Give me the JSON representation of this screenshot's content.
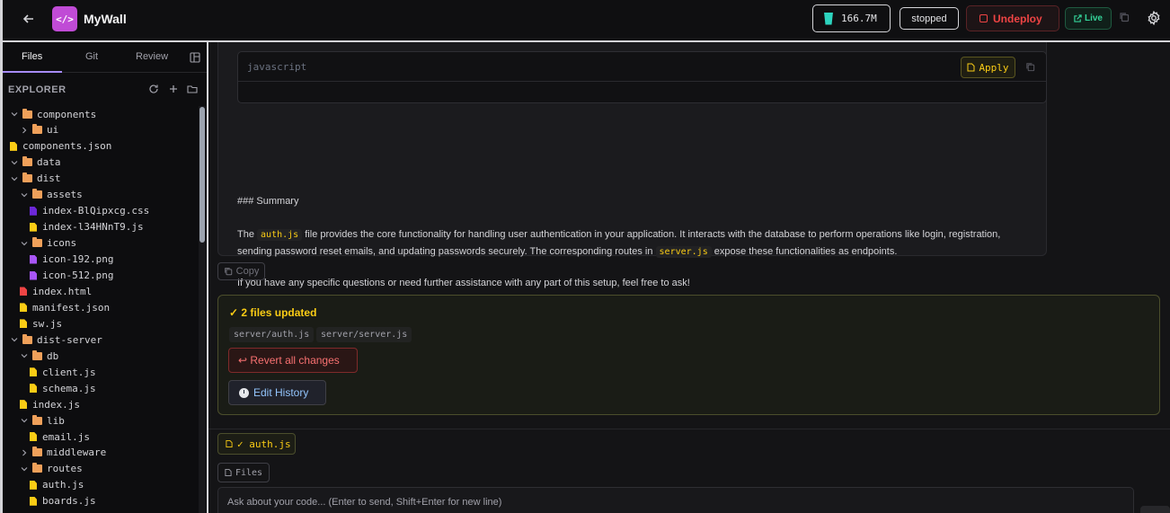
{
  "header": {
    "app_title": "MyWall",
    "logo_glyph": "</>",
    "tokens": "166.7M",
    "status": "stopped",
    "undeploy_label": "Undeploy",
    "live_label": "Live"
  },
  "sidebar": {
    "tabs": [
      "Files",
      "Git",
      "Review"
    ],
    "explorer_title": "EXPLORER",
    "tree": [
      {
        "name": "components",
        "type": "folder",
        "depth": 0,
        "expanded": true
      },
      {
        "name": "ui",
        "type": "folder",
        "depth": 1,
        "expanded": false
      },
      {
        "name": "components.json",
        "type": "file",
        "depth": 0,
        "color": "#facc15"
      },
      {
        "name": "data",
        "type": "folder",
        "depth": 0,
        "expanded": true
      },
      {
        "name": "dist",
        "type": "folder",
        "depth": 0,
        "expanded": true
      },
      {
        "name": "assets",
        "type": "folder",
        "depth": 1,
        "expanded": true
      },
      {
        "name": "index-BlQipxcg.css",
        "type": "file",
        "depth": 2,
        "color": "#6d28d9"
      },
      {
        "name": "index-l34HNnT9.js",
        "type": "file",
        "depth": 2,
        "color": "#facc15"
      },
      {
        "name": "icons",
        "type": "folder",
        "depth": 1,
        "expanded": true
      },
      {
        "name": "icon-192.png",
        "type": "file",
        "depth": 2,
        "color": "#a855f7"
      },
      {
        "name": "icon-512.png",
        "type": "file",
        "depth": 2,
        "color": "#a855f7"
      },
      {
        "name": "index.html",
        "type": "file",
        "depth": 1,
        "color": "#ef4444"
      },
      {
        "name": "manifest.json",
        "type": "file",
        "depth": 1,
        "color": "#facc15"
      },
      {
        "name": "sw.js",
        "type": "file",
        "depth": 1,
        "color": "#facc15"
      },
      {
        "name": "dist-server",
        "type": "folder",
        "depth": 0,
        "expanded": true
      },
      {
        "name": "db",
        "type": "folder",
        "depth": 1,
        "expanded": true
      },
      {
        "name": "client.js",
        "type": "file",
        "depth": 2,
        "color": "#facc15"
      },
      {
        "name": "schema.js",
        "type": "file",
        "depth": 2,
        "color": "#facc15"
      },
      {
        "name": "index.js",
        "type": "file",
        "depth": 1,
        "color": "#facc15"
      },
      {
        "name": "lib",
        "type": "folder",
        "depth": 1,
        "expanded": true
      },
      {
        "name": "email.js",
        "type": "file",
        "depth": 2,
        "color": "#facc15"
      },
      {
        "name": "middleware",
        "type": "folder",
        "depth": 1,
        "expanded": false
      },
      {
        "name": "routes",
        "type": "folder",
        "depth": 1,
        "expanded": true
      },
      {
        "name": "auth.js",
        "type": "file",
        "depth": 2,
        "color": "#facc15"
      },
      {
        "name": "boards.js",
        "type": "file",
        "depth": 2,
        "color": "#facc15"
      }
    ]
  },
  "message": {
    "code_lang": "javascript",
    "apply_label": "Apply",
    "summary_heading": "### Summary",
    "p1_before": "The",
    "p1_code1": "auth.js",
    "p1_mid": "file provides the core functionality for handling user authentication in your application. It interacts with the database to perform operations like login, registration, sending password reset emails, and updating passwords securely. The corresponding routes in",
    "p1_code2": "server.js",
    "p1_after": "expose these functionalities as endpoints.",
    "p2": "If you have any specific questions or need further assistance with any part of this setup, feel free to ask!",
    "copy_label": "Copy"
  },
  "files_updated": {
    "title": "✓ 2 files updated",
    "files": [
      "server/auth.js",
      "server/server.js"
    ],
    "revert_label": "↩ Revert all changes",
    "history_label": "Edit History"
  },
  "composer": {
    "active_file": "✓ auth.js",
    "files_label": "Files",
    "placeholder": "Ask about your code... (Enter to send, Shift+Enter for new line)"
  }
}
